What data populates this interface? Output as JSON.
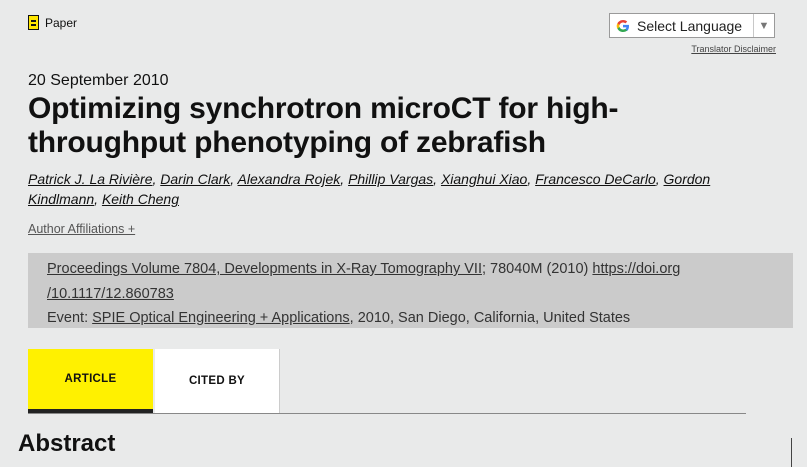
{
  "header": {
    "tag_label": "Paper",
    "language": {
      "label": "Select Language",
      "disclaimer": "Translator Disclaimer"
    }
  },
  "paper": {
    "date": "20 September 2010",
    "title": "Optimizing synchrotron microCT for high-throughput phenotyping of zebrafish",
    "authors": [
      "Patrick J. La Rivière",
      "Darin Clark",
      "Alexandra Rojek",
      "Phillip Vargas",
      "Xianghui Xiao",
      "Francesco DeCarlo",
      "Gordon Kindlmann",
      "Keith Cheng"
    ],
    "author_affiliations_label": "Author Affiliations +"
  },
  "proceedings": {
    "volume_link": "Proceedings Volume 7804, Developments in X-Ray Tomography VII;",
    "article_number": "78040M (2010)",
    "doi_part1": "https://doi.org",
    "doi_part2": "/10.1117/12.860783",
    "event_prefix": "Event:",
    "event_link": "SPIE Optical Engineering + Applications",
    "event_rest": ", 2010, San Diego, California, United States"
  },
  "tabs": [
    {
      "label": "ARTICLE",
      "active": true
    },
    {
      "label": "CITED BY",
      "active": false
    }
  ],
  "abstract_heading": "Abstract",
  "colors": {
    "accent": "#fff100",
    "background": "#e9eaea",
    "proceedings_bg": "#cbcbcb"
  }
}
